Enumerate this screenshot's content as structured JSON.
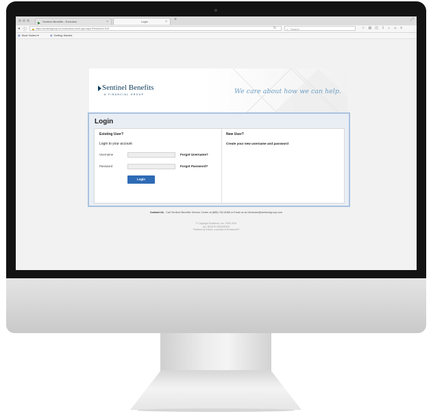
{
  "browser": {
    "tabs": [
      {
        "label": "Sentinel Benefits - Evolution",
        "active": false
      },
      {
        "label": "Login",
        "active": true
      }
    ],
    "url": "https://sentinelgroup.ml.ondemand.com/Login.aspx?ReturnUrl=%2f",
    "search_placeholder": "Search",
    "bookmarks": [
      "Most Visited",
      "Getting Started"
    ]
  },
  "banner": {
    "logo_name": "Sentinel Benefits",
    "logo_sub": "& FINANCIAL GROUP",
    "tagline": "We care about how we can help."
  },
  "login": {
    "title": "Login",
    "existing_heading": "Existing User?",
    "existing_sub": "Login to your account",
    "username_label": "Username",
    "password_label": "Password",
    "forgot_username": "Forgot Username?",
    "forgot_password": "Forgot Password?",
    "button_label": "Login",
    "new_heading": "New User?",
    "new_link": "Create your new username and password"
  },
  "footer": {
    "contact_label": "Contact Us",
    "contact_text": " - Call Sentinel Benefits Service Center at (888) 762-6088 or Email us at clientcare@sentinelgroup.com",
    "copyright_1": "© Copyright Evolution1, Inc. 2004-2016",
    "copyright_2": "ALL RIGHTS RESERVED",
    "copyright_3": "Powered by iCloud, a product of Evolution1®"
  }
}
